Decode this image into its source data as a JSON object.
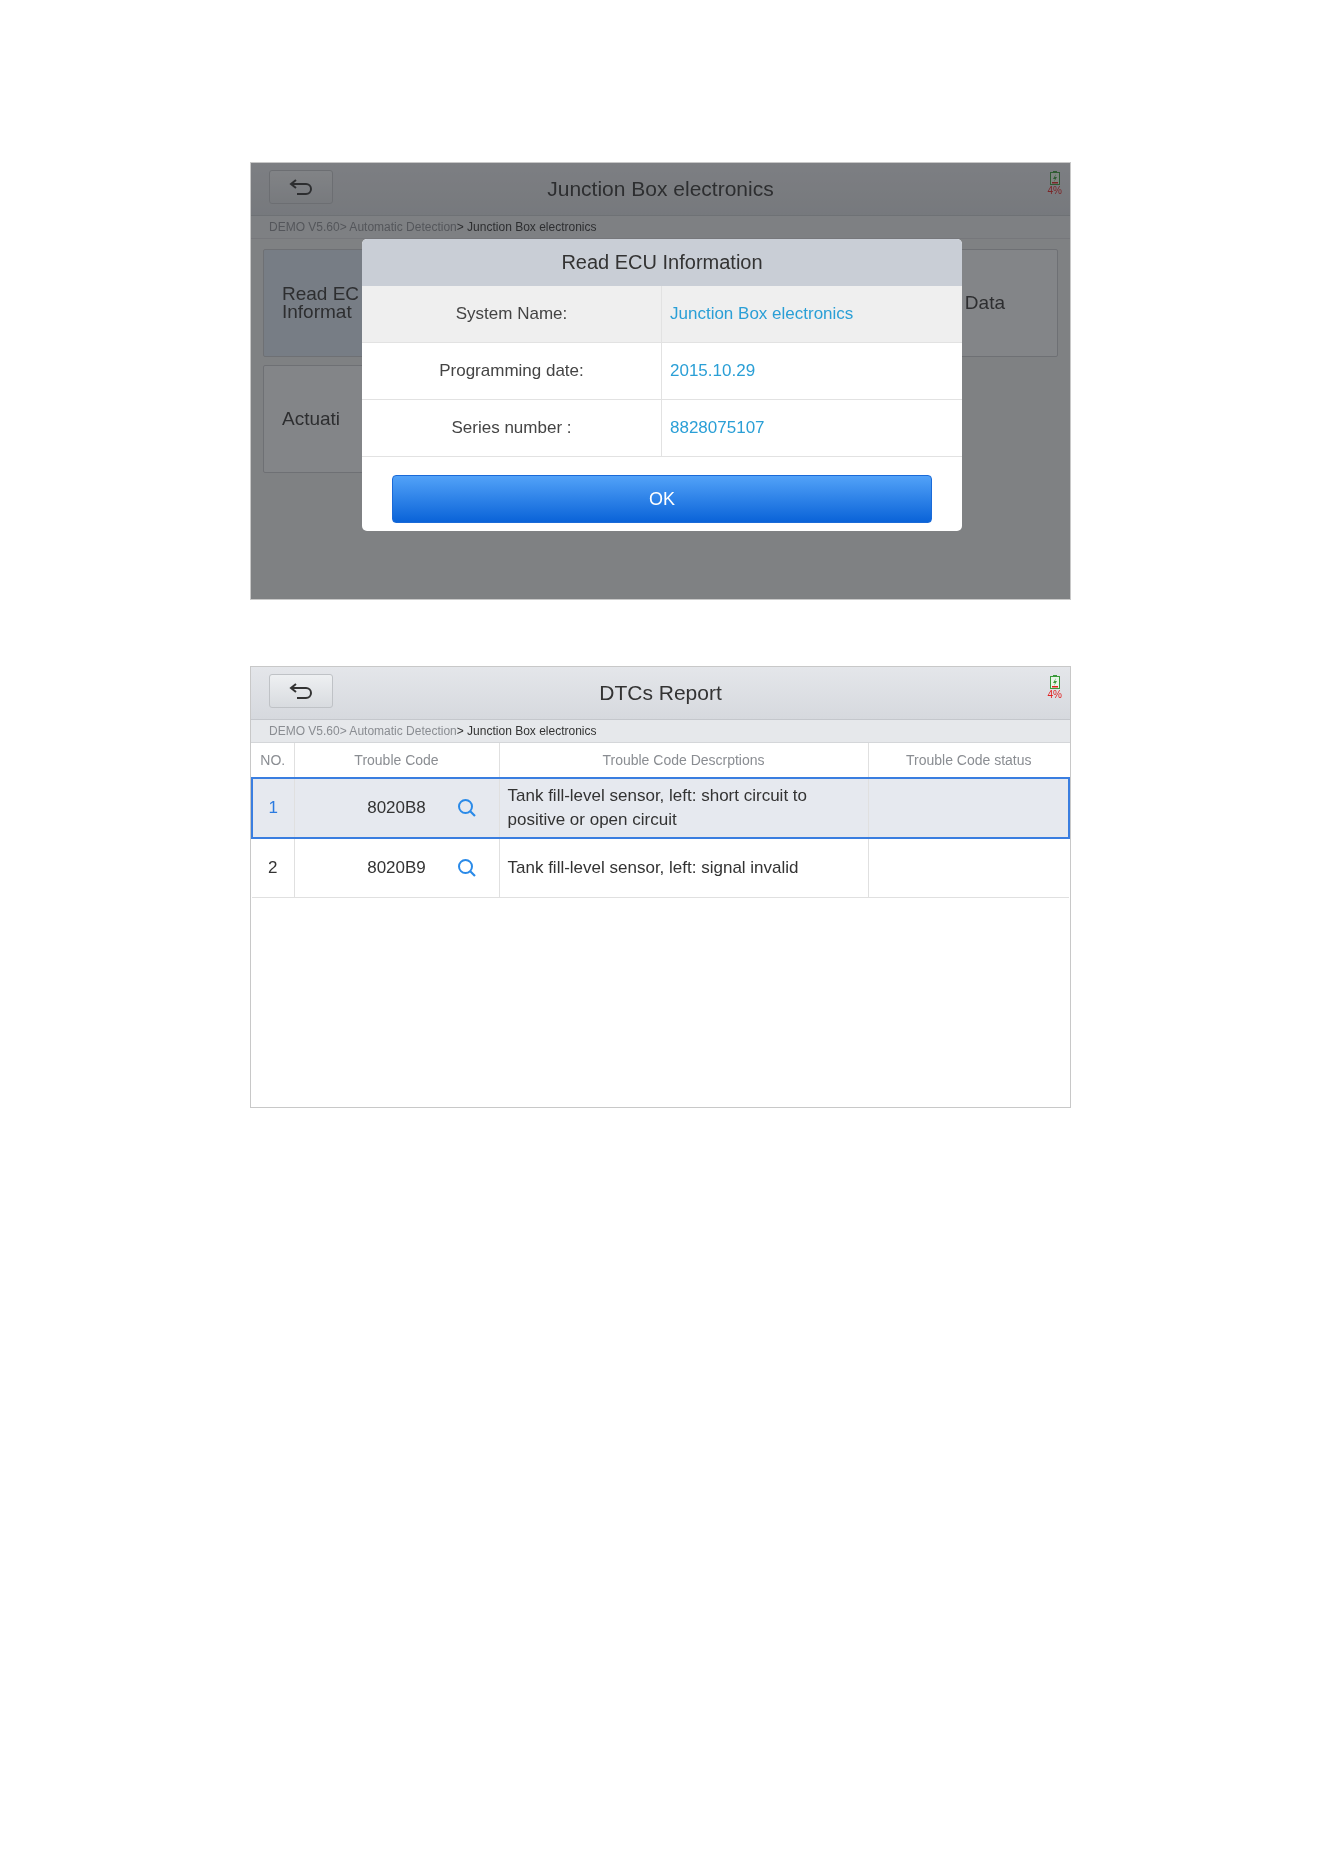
{
  "screens": [
    {
      "kind": "dialog",
      "title": "Junction Box electronics",
      "battery": "4%",
      "breadcrumb": {
        "path": "DEMO V5.60> Automatic Detection",
        "current": "> Junction Box electronics"
      },
      "tiles": [
        {
          "lines": [
            "Read EC",
            "Informat"
          ]
        },
        {
          "lines": [
            "Data"
          ]
        },
        {
          "lines": [
            "Actuati"
          ]
        }
      ],
      "dialog": {
        "title": "Read ECU Information",
        "rows": [
          {
            "label": "System Name:",
            "value": "Junction Box electronics"
          },
          {
            "label": "Programming date:",
            "value": "2015.10.29"
          },
          {
            "label": "Series number :",
            "value": "8828075107"
          }
        ],
        "button": "OK"
      }
    },
    {
      "kind": "table",
      "title": "DTCs Report",
      "battery": "4%",
      "breadcrumb": {
        "path": "DEMO V5.60> Automatic Detection",
        "current": "> Junction Box electronics"
      },
      "columns": [
        "NO.",
        "Trouble Code",
        "Trouble Code Descrptions",
        "Trouble Code status"
      ],
      "rows": [
        {
          "no": "1",
          "code": "8020B8",
          "description": "Tank fill-level sensor, left: short circuit to positive or open circuit",
          "selected": true
        },
        {
          "no": "2",
          "code": "8020B9",
          "description": "Tank fill-level sensor, left: signal invalid",
          "selected": false
        }
      ]
    }
  ]
}
